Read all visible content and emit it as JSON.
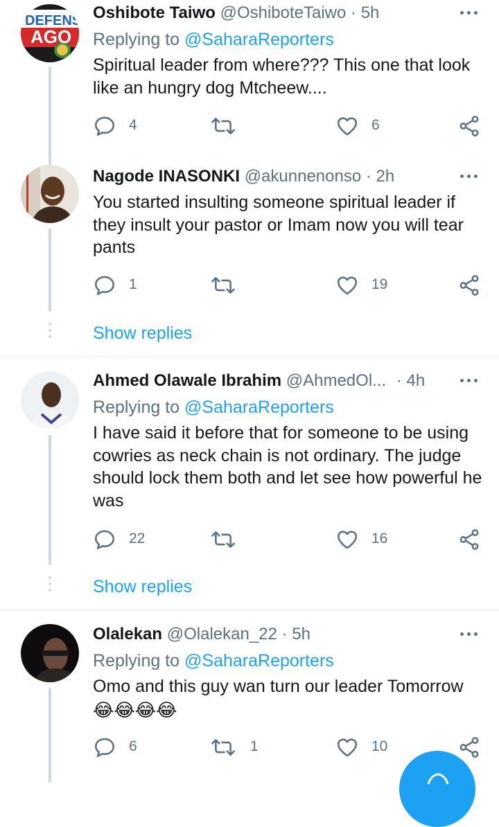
{
  "tweets": [
    {
      "name": "Oshibote Taiwo",
      "handle": "@OshiboteTaiwo",
      "separator": "·",
      "time": "5h",
      "replying_prefix": "Replying to",
      "replying_to": "@SaharaReporters",
      "text": "Spiritual leader from where???  This one that look like an hungry dog Mtcheew....",
      "avatar_text_top": "DEFENS",
      "avatar_text_bottom": "AGO",
      "reply_count": "4",
      "retweet_count": "",
      "like_count": "6"
    },
    {
      "name": "Nagode INASONKI",
      "handle": "@akunnenonso",
      "separator": "·",
      "time": "2h",
      "text": "You started insulting someone spiritual leader if they insult your pastor or Imam now you will tear pants",
      "reply_count": "1",
      "retweet_count": "",
      "like_count": "19",
      "show_replies": "Show replies"
    },
    {
      "name": "Ahmed Olawale Ibrahim",
      "handle": "@AhmedOl...",
      "separator": "·",
      "time": "4h",
      "replying_prefix": "Replying to",
      "replying_to": "@SaharaReporters",
      "text": "I have said it before that for someone to be using cowries as neck chain is not ordinary. The judge should lock them both and let see how powerful he was",
      "reply_count": "22",
      "retweet_count": "",
      "like_count": "16",
      "show_replies": "Show replies"
    },
    {
      "name": "Olalekan",
      "handle": "@Olalekan_22",
      "separator": "·",
      "time": "5h",
      "replying_prefix": "Replying to",
      "replying_to": "@SaharaReporters",
      "text": "Omo and this guy wan turn our leader Tomorrow",
      "emoji": "😂😂😂😂",
      "reply_count": "6",
      "retweet_count": "1",
      "like_count": "10"
    }
  ],
  "icons": {
    "reply": "reply-icon",
    "retweet": "retweet-icon",
    "like": "heart-icon",
    "share": "share-icon",
    "more": "more-icon",
    "compose": "compose-icon"
  },
  "colors": {
    "accent": "#1da1f2",
    "secondary_text": "#5b7083",
    "primary_text": "#14171a",
    "thread_line": "#cfd9de"
  }
}
